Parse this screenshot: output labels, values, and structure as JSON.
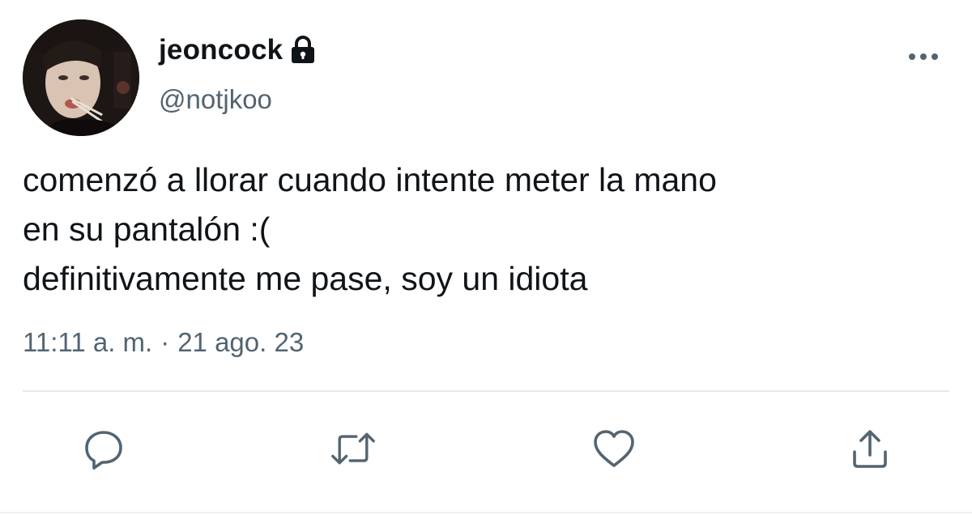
{
  "author": {
    "display_name": "jeoncock",
    "handle": "@notjkoo",
    "protected_icon": "lock-icon",
    "avatar": "profile photo"
  },
  "tweet": {
    "lines": [
      "comenzó a llorar cuando intente meter la mano",
      "en su pantalón :(",
      "definitivamente me pase, soy un idiota"
    ]
  },
  "meta": {
    "time": "11:11 a. m.",
    "separator": "·",
    "date": "21 ago. 23"
  },
  "actions": [
    {
      "icon": "reply-icon"
    },
    {
      "icon": "retweet-icon"
    },
    {
      "icon": "like-icon"
    },
    {
      "icon": "share-icon"
    }
  ],
  "more_icon": "more-icon",
  "colors": {
    "text": "#0f1419",
    "secondary": "#536471",
    "divider": "#e7e9ea"
  }
}
